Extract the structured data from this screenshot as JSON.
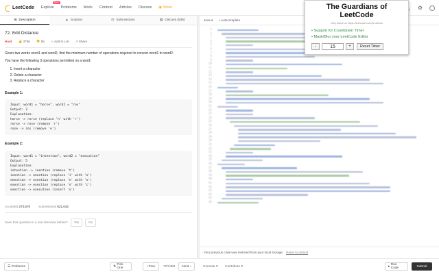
{
  "nav": {
    "logo": "LeetCode",
    "items": [
      "Explore",
      "Problems",
      "Mock",
      "Contest",
      "Articles",
      "Discuss"
    ],
    "explore_badge": "New",
    "store": "Store"
  },
  "tabs": [
    "Description",
    "Solution",
    "Submissions",
    "Discuss (838)"
  ],
  "problem": {
    "title": "72. Edit Distance",
    "difficulty": "Hard",
    "likes": "3786",
    "dislikes": "55",
    "add_to_list": "Add to List",
    "share": "Share",
    "desc1": "Given two words word1 and word2, find the minimum number of operations required to convert word1 to word2.",
    "desc2": "You have the following 3 operations permitted on a word:",
    "ops": [
      "Insert a character",
      "Delete a character",
      "Replace a character"
    ],
    "ex1_title": "Example 1:",
    "ex1_lines": [
      "Input: word1 = \"horse\", word2 = \"ros\"",
      "Output: 3",
      "Explanation:",
      "horse -> rorse (replace 'h' with 'r')",
      "rorse -> rose (remove 'r')",
      "rose -> ros (remove 'e')"
    ],
    "ex2_title": "Example 2:",
    "ex2_lines": [
      "Input: word1 = \"intention\", word2 = \"execution\"",
      "Output: 5",
      "Explanation:",
      "intention -> inention (remove 't')",
      "inention -> enention (replace 'i' with 'e')",
      "enention -> exention (replace 'n' with 'x')",
      "exention -> exection (replace 'n' with 'c')",
      "exection -> execution (insert 'u')"
    ],
    "accepted_label": "Accepted",
    "accepted": "273,570",
    "submissions_label": "Submissions",
    "submissions": "621,042",
    "interview_q": "Seen this question in a real interview before?",
    "yes": "Yes",
    "no": "No"
  },
  "editor": {
    "language": "Java",
    "autocomplete": "Autocomplete",
    "restore_msg": "Your previous code was restored from your local storage.",
    "reset_link": "Reset to default"
  },
  "footer": {
    "problems": "Problems",
    "pick_one": "Pick One",
    "prev": "Prev",
    "page": "72/1483",
    "next": "Next",
    "console": "Console",
    "contribute": "Contribute",
    "run": "Run Code",
    "submit": "Submit"
  },
  "popup": {
    "title": "The Guardians of LeetCode",
    "subtitle": "Only active on https://leetcode.com/problems",
    "features": [
      "Support for Countdown Timer",
      "Mask/Blur your LeetCode Editor"
    ],
    "minus": "-",
    "value": "15",
    "plus": "+",
    "reset": "Reset Timer"
  },
  "colors": {
    "brand": "#ffa116",
    "hard": "#ef4743",
    "feature": "#2d8a4a"
  }
}
